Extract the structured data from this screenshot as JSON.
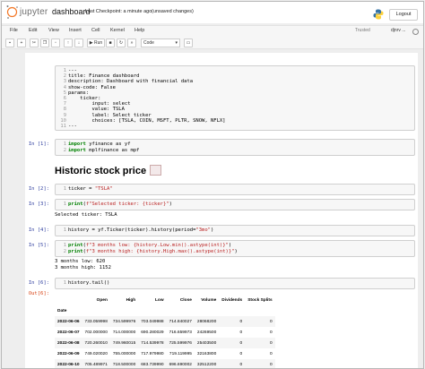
{
  "header": {
    "brand": "jupyter",
    "notebook_name": "dashboard",
    "checkpoint": "Last Checkpoint: a minute ago",
    "save_status": "(unsaved changes)",
    "logout_label": "Logout"
  },
  "menubar": {
    "items": [
      "File",
      "Edit",
      "View",
      "Insert",
      "Cell",
      "Kernel",
      "Help"
    ],
    "trusted": "Trusted",
    "kernel_name": "djnrv ..."
  },
  "toolbar": {
    "run_label": "Run",
    "cell_type": "Code"
  },
  "cells": {
    "params": {
      "line_numbers": [
        "1",
        "2",
        "3",
        "4",
        "5",
        "6",
        "7",
        "8",
        "9",
        "10",
        "11"
      ],
      "lines": [
        "---",
        "title: Finance dashboard",
        "description: Dashboard with financial data",
        "show-code: False",
        "params:",
        "    ticker:",
        "        input: select",
        "        value: TSLA",
        "        label: Select ticker",
        "        choices: [TSLA, COIN, MSFT, PLTR, SNOW, NFLX]",
        "---"
      ]
    },
    "c1": {
      "prompt": "In [1]:",
      "l1": "import yfinance as yf",
      "l2": "import mplfinance as mpf"
    },
    "heading": "Historic stock price",
    "c2": {
      "prompt": "In [2]:",
      "code": "ticker = \"TSLA\""
    },
    "c3": {
      "prompt": "In [3]:",
      "code": "print(f\"Selected ticker: {ticker}\")",
      "output": "Selected ticker: TSLA"
    },
    "c4": {
      "prompt": "In [4]:",
      "code": "history = yf.Ticker(ticker).history(period=\"3mo\")"
    },
    "c5": {
      "prompt": "In [5]:",
      "l1": "print(f\"3 months low: {history.Low.min().astype(int)}\")",
      "l2": "print(f\"3 months high: {history.High.max().astype(int)}\")",
      "out1": "3 months low: 620",
      "out2": "3 months high: 1152"
    },
    "c6": {
      "prompt": "In [6]:",
      "code": "history.tail()",
      "out_prompt": "Out[6]:"
    }
  },
  "table": {
    "columns": [
      "Open",
      "High",
      "Low",
      "Close",
      "Volume",
      "Dividends",
      "Stock Splits"
    ],
    "index_name": "Date",
    "rows": [
      [
        "2022-06-06",
        "733.059998",
        "734.599976",
        "703.049988",
        "714.840027",
        "28068200",
        "0",
        "0"
      ],
      [
        "2022-06-07",
        "702.000000",
        "714.000000",
        "690.280029",
        "716.659973",
        "24269500",
        "0",
        "0"
      ],
      [
        "2022-06-08",
        "720.260010",
        "749.960015",
        "714.539978",
        "725.599976",
        "25403500",
        "0",
        "0"
      ],
      [
        "2022-06-09",
        "749.020020",
        "755.000000",
        "717.979980",
        "719.119995",
        "32163800",
        "0",
        "0"
      ],
      [
        "2022-06-10",
        "705.489971",
        "718.500000",
        "683.739990",
        "696.690002",
        "32512200",
        "0",
        "0"
      ]
    ]
  }
}
